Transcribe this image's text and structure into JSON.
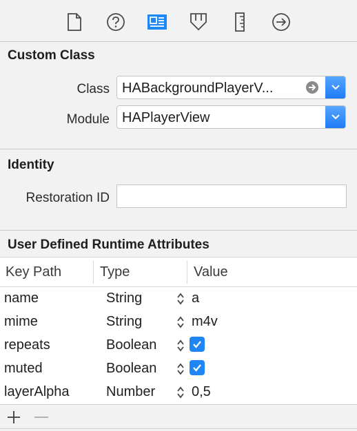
{
  "toolbar": {
    "tabs": [
      {
        "icon": "file-icon"
      },
      {
        "icon": "help-icon"
      },
      {
        "icon": "identity-inspector-icon",
        "active": true
      },
      {
        "icon": "attributes-icon"
      },
      {
        "icon": "size-ruler-icon"
      },
      {
        "icon": "connections-arrow-icon"
      }
    ],
    "accent": "#1e87f5"
  },
  "custom_class": {
    "title": "Custom Class",
    "class_label": "Class",
    "class_value": "HABackgroundPlayerV...",
    "module_label": "Module",
    "module_value": "HAPlayerView"
  },
  "identity": {
    "title": "Identity",
    "restoration_label": "Restoration ID",
    "restoration_value": ""
  },
  "runtime_attributes": {
    "title": "User Defined Runtime Attributes",
    "columns": [
      "Key Path",
      "Type",
      "Value"
    ],
    "rows": [
      {
        "key": "name",
        "type": "String",
        "value": "a",
        "checkbox": false
      },
      {
        "key": "mime",
        "type": "String",
        "value": "m4v",
        "checkbox": false
      },
      {
        "key": "repeats",
        "type": "Boolean",
        "value": "",
        "checkbox": true,
        "checked": true
      },
      {
        "key": "muted",
        "type": "Boolean",
        "value": "",
        "checkbox": true,
        "checked": true
      },
      {
        "key": "layerAlpha",
        "type": "Number",
        "value": "0,5",
        "checkbox": false
      }
    ],
    "footer": {
      "add_icon": "plus-icon",
      "remove_icon": "minus-icon"
    }
  }
}
